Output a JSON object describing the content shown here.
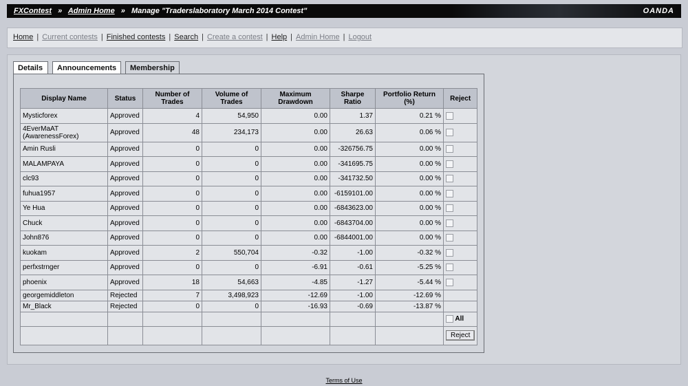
{
  "header": {
    "crumb1": "FXContest",
    "crumb2": "Admin Home",
    "crumb3": "Manage \"Traderslaboratory March 2014 Contest\"",
    "separator": "»",
    "brand": "OANDA"
  },
  "nav": {
    "items": [
      {
        "label": "Home"
      },
      {
        "label": "Current contests"
      },
      {
        "label": "Finished contests"
      },
      {
        "label": "Search"
      },
      {
        "label": "Create a contest"
      },
      {
        "label": "Help"
      },
      {
        "label": "Admin Home"
      },
      {
        "label": "Logout"
      }
    ],
    "divider": "|"
  },
  "tabs": [
    {
      "label": "Details"
    },
    {
      "label": "Announcements"
    },
    {
      "label": "Membership"
    }
  ],
  "table": {
    "columns": [
      "Display Name",
      "Status",
      "Number of Trades",
      "Volume of Trades",
      "Maximum Drawdown",
      "Sharpe Ratio",
      "Portfolio Return (%)",
      "Reject"
    ],
    "rows": [
      {
        "name": "Mysticforex",
        "status": "Approved",
        "trades": "4",
        "volume": "54,950",
        "drawdown": "0.00",
        "sharpe": "1.37",
        "ret": "0.21 %",
        "checkbox": true
      },
      {
        "name": "4EverMaAT (AwarenessForex)",
        "status": "Approved",
        "trades": "48",
        "volume": "234,173",
        "drawdown": "0.00",
        "sharpe": "26.63",
        "ret": "0.06 %",
        "checkbox": true
      },
      {
        "name": "Amin Rusli",
        "status": "Approved",
        "trades": "0",
        "volume": "0",
        "drawdown": "0.00",
        "sharpe": "-326756.75",
        "ret": "0.00 %",
        "checkbox": true
      },
      {
        "name": "MALAMPAYA",
        "status": "Approved",
        "trades": "0",
        "volume": "0",
        "drawdown": "0.00",
        "sharpe": "-341695.75",
        "ret": "0.00 %",
        "checkbox": true
      },
      {
        "name": "clc93",
        "status": "Approved",
        "trades": "0",
        "volume": "0",
        "drawdown": "0.00",
        "sharpe": "-341732.50",
        "ret": "0.00 %",
        "checkbox": true
      },
      {
        "name": "fuhua1957",
        "status": "Approved",
        "trades": "0",
        "volume": "0",
        "drawdown": "0.00",
        "sharpe": "-6159101.00",
        "ret": "0.00 %",
        "checkbox": true
      },
      {
        "name": "Ye Hua",
        "status": "Approved",
        "trades": "0",
        "volume": "0",
        "drawdown": "0.00",
        "sharpe": "-6843623.00",
        "ret": "0.00 %",
        "checkbox": true
      },
      {
        "name": "Chuck",
        "status": "Approved",
        "trades": "0",
        "volume": "0",
        "drawdown": "0.00",
        "sharpe": "-6843704.00",
        "ret": "0.00 %",
        "checkbox": true
      },
      {
        "name": "John876",
        "status": "Approved",
        "trades": "0",
        "volume": "0",
        "drawdown": "0.00",
        "sharpe": "-6844001.00",
        "ret": "0.00 %",
        "checkbox": true
      },
      {
        "name": "kuokam",
        "status": "Approved",
        "trades": "2",
        "volume": "550,704",
        "drawdown": "-0.32",
        "sharpe": "-1.00",
        "ret": "-0.32 %",
        "checkbox": true
      },
      {
        "name": "perfxstrnger",
        "status": "Approved",
        "trades": "0",
        "volume": "0",
        "drawdown": "-6.91",
        "sharpe": "-0.61",
        "ret": "-5.25 %",
        "checkbox": true
      },
      {
        "name": "phoenix",
        "status": "Approved",
        "trades": "18",
        "volume": "54,663",
        "drawdown": "-4.85",
        "sharpe": "-1.27",
        "ret": "-5.44 %",
        "checkbox": true
      },
      {
        "name": "georgemiddleton",
        "status": "Rejected",
        "trades": "7",
        "volume": "3,498,923",
        "drawdown": "-12.69",
        "sharpe": "-1.00",
        "ret": "-12.69 %",
        "checkbox": false
      },
      {
        "name": "Mr_Black",
        "status": "Rejected",
        "trades": "0",
        "volume": "0",
        "drawdown": "-16.93",
        "sharpe": "-0.69",
        "ret": "-13.87 %",
        "checkbox": false
      }
    ],
    "all_label": "All",
    "reject_button": "Reject"
  },
  "footer": {
    "terms": "Terms of Use"
  }
}
